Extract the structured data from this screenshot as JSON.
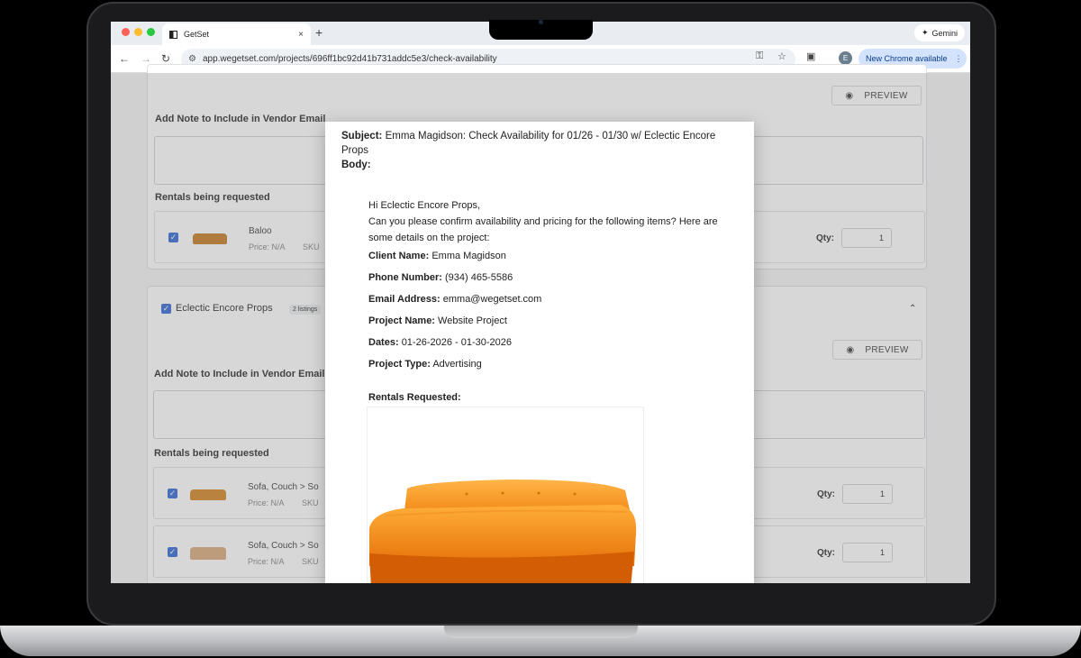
{
  "browser": {
    "tab_title": "GetSet",
    "tab_close": "×",
    "new_tab": "+",
    "gemini_label": "Gemini",
    "url": "app.wegetset.com/projects/696ff1bc92d41b731addc5e3/check-availability",
    "profile_initial": "E",
    "update_label": "New Chrome available",
    "colors": {
      "red": "#ff5f57",
      "yellow": "#febc2e",
      "green": "#28c840",
      "update_bg": "#d3e3fd"
    }
  },
  "page": {
    "preview_label": "PREVIEW",
    "note_label": "Add Note to Include in Vendor Email",
    "rentals_label": "Rentals being requested",
    "qty_label": "Qty:",
    "section1": {
      "items": [
        {
          "title": "Baloo",
          "price": "Price: N/A",
          "sku": "SKU",
          "qty": "1"
        }
      ]
    },
    "section2": {
      "vendor": "Eclectic Encore Props",
      "badge": "2 listings",
      "items": [
        {
          "title": "Sofa, Couch > So",
          "price": "Price: N/A",
          "sku": "SKU",
          "qty": "1"
        },
        {
          "title": "Sofa, Couch > So",
          "price": "Price: N/A",
          "sku": "SKU",
          "qty": "1"
        }
      ]
    }
  },
  "modal": {
    "subject_label": "Subject:",
    "subject": "Emma Magidson: Check Availability for 01/26 - 01/30 w/ Eclectic Encore Props",
    "body_label": "Body:",
    "greeting": "Hi Eclectic Encore Props,",
    "intro": "Can you please confirm availability and pricing for the following items? Here are some details on the project:",
    "fields": [
      {
        "label": "Client Name:",
        "value": "Emma Magidson"
      },
      {
        "label": "Phone Number:",
        "value": "(934) 465-5586"
      },
      {
        "label": "Email Address:",
        "value": "emma@wegetset.com"
      },
      {
        "label": "Project Name:",
        "value": "Website Project"
      },
      {
        "label": "Dates:",
        "value": "01-26-2026 - 01-30-2026"
      },
      {
        "label": "Project Type:",
        "value": "Advertising"
      }
    ],
    "rentals_requested": "Rentals Requested:",
    "sofa_color": "#f58a12"
  }
}
